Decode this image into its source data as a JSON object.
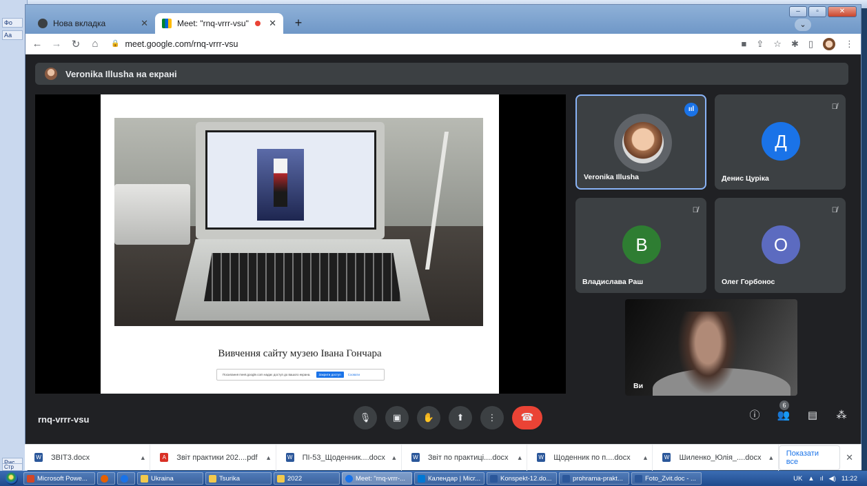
{
  "word": {
    "strip": [
      "Фо",
      "Аа",
      "Ст",
      "Рис",
      "Стр"
    ]
  },
  "browser": {
    "tabs": [
      {
        "label": "Нова вкладка",
        "active": false
      },
      {
        "label": "Meet: \"rnq-vrrr-vsu\"",
        "active": true
      }
    ],
    "url": "meet.google.com/rnq-vrrr-vsu"
  },
  "meet": {
    "presenting_label": "Veronika Illusha на екрані",
    "slide": {
      "title": "Вивчення сайту музею Івана Гончара",
      "share_text": "Посилання meet.google.com надає доступ до вашого екрана.",
      "stop_label": "Закрити доступ",
      "hide_label": "Сховати"
    },
    "participants": [
      {
        "name": "Veronika Illusha",
        "letter": "",
        "color": "#5f6368",
        "speaking": true,
        "muted": false
      },
      {
        "name": "Денис Цурiка",
        "letter": "Д",
        "color": "#1a73e8",
        "speaking": false,
        "muted": true
      },
      {
        "name": "Владислава Раш",
        "letter": "В",
        "color": "#2e7d32",
        "speaking": false,
        "muted": true
      },
      {
        "name": "Олег Горбонос",
        "letter": "О",
        "color": "#5c6bc0",
        "speaking": false,
        "muted": true
      }
    ],
    "self_name": "Ви",
    "meeting_code": "rnq-vrrr-vsu",
    "people_count": "6"
  },
  "downloads": [
    {
      "name": "ЗВІТ3.docx",
      "type": "word"
    },
    {
      "name": "Звіт практики 202....pdf",
      "type": "pdf"
    },
    {
      "name": "ПІ-53_Щоденник....docx",
      "type": "word"
    },
    {
      "name": "Звіт по практиці....docx",
      "type": "word"
    },
    {
      "name": "Щоденник по п....docx",
      "type": "word"
    },
    {
      "name": "Шиленко_Юлія_....docx",
      "type": "word"
    }
  ],
  "show_all_label": "Показати все",
  "taskbar": {
    "items": [
      "Microsoft Powe...",
      "",
      "",
      "Ukraina",
      "Tsurika",
      "2022",
      "Meet: \"rnq-vrrr-...",
      "Календар | Micr...",
      "Konspekt-12.do...",
      "prohrama-prakt...",
      "Foto_Zvit.doc - ..."
    ],
    "lang": "UK",
    "time": "11:22"
  },
  "colors": {
    "meet_bg": "#202124",
    "tile_bg": "#3c4043",
    "hangup": "#ea4335",
    "accent": "#1a73e8"
  }
}
